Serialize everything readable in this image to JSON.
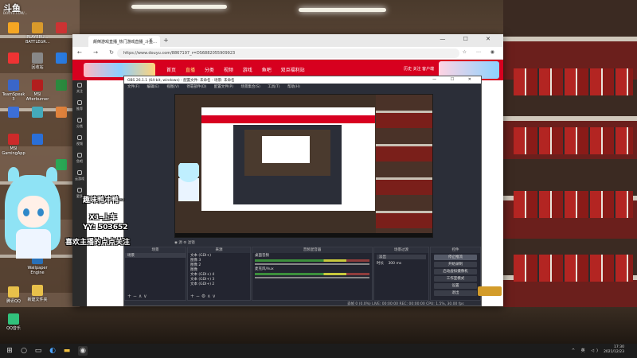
{
  "watermark": {
    "logo": "斗鱼",
    "url": "DOUYU.COM/..."
  },
  "desktop": {
    "icons": [
      {
        "label": "",
        "color": "#f5a623"
      },
      {
        "label": "PLAYERU… BATTLEGR…",
        "color": "#d99a2b"
      },
      {
        "label": "",
        "color": "#c33"
      },
      {
        "label": "",
        "color": "#e33"
      },
      {
        "label": "回收站",
        "color": "#888"
      },
      {
        "label": "",
        "color": "#2a7be0"
      },
      {
        "label": "TeamSpeak 3",
        "color": "#3a66c9"
      },
      {
        "label": "MSI Afterburner",
        "color": "#b21e1e"
      },
      {
        "label": "",
        "color": "#2b8a3e"
      },
      {
        "label": "",
        "color": "#3c6fd8"
      },
      {
        "label": "",
        "color": "#4ab"
      },
      {
        "label": "",
        "color": "#e0823c"
      },
      {
        "label": "MSI GamingApp",
        "color": "#cc2a2a"
      },
      {
        "label": "",
        "color": "#2a6fd8"
      },
      {
        "label": "",
        "color": "#2aa855"
      },
      {
        "label": "",
        "color": "#d9d"
      },
      {
        "label": "Wallpaper Engine",
        "color": "#2870b8"
      },
      {
        "label": "新建文件夹",
        "color": "#e8c04a"
      },
      {
        "label": "腾讯QQ",
        "color": "#2aa8e0"
      },
      {
        "label": "QQ音乐",
        "color": "#31c27c"
      }
    ]
  },
  "browser": {
    "tab_title": "颠倒游戏直播_热门游戏直播_斗鱼…",
    "url": "https://www.douyu.com/8867197_r=DS6882055909923",
    "window_controls": "— ☐ ✕",
    "nav_icons": "← → ↻ ⌂",
    "addr_icons": "☆ ⋯ ◉",
    "site_nav": [
      "首页",
      "直播",
      "分类",
      "视频",
      "游戏",
      "鱼吧",
      "双旦福利站"
    ],
    "site_right": "历史 关注 客户端",
    "rail": [
      "关注",
      "推荐",
      "分类",
      "视频",
      "鱼吧",
      "云游戏",
      "更多"
    ]
  },
  "obs": {
    "title": "OBS 26.1.1 (64-bit, windows) - 配置文件: 未命名 - 场景: 未命名",
    "window_controls": "— ☐ ✕",
    "menu": [
      "文件(F)",
      "编辑(E)",
      "视图(V)",
      "停靠部件(D)",
      "配置文件(P)",
      "场景集合(S)",
      "工具(T)",
      "帮助(H)"
    ],
    "preview_controls": "◉ 源  ⚙ 滤镜",
    "docks": {
      "scenes": {
        "title": "场景",
        "items": [
          "场景"
        ]
      },
      "sources": {
        "title": "来源",
        "items": [
          "文本 (GDI+)",
          "图像 3",
          "图像 2",
          "图像",
          "文本 (GDI+) 4",
          "文本 (GDI+) 3",
          "文本 (GDI+) 2",
          "文本 (GDI+)"
        ]
      },
      "mixer": {
        "title": "音频混音器",
        "tracks": [
          {
            "name": "桌面音频",
            "level": "0.0 dB"
          },
          {
            "name": "麦克风/Aux",
            "level": "0.0 dB"
          }
        ]
      },
      "transitions": {
        "title": "场景过渡",
        "type": "淡出",
        "duration_label": "时长",
        "duration": "300 ms"
      },
      "controls": {
        "title": "控件",
        "buttons": [
          "停止推流",
          "开始录制",
          "启动虚拟摄像机",
          "工作室模式",
          "设置",
          "退出"
        ]
      }
    },
    "status": "丢帧 0 (0.0%)  LIVE: 00:00:00  REC: 00:00:00  CPU: 1.5%, 30.00 fps"
  },
  "overlay": {
    "line1": "趣味鸭冲鸭~",
    "line2": "X1-上车",
    "line3": "YY: 503652",
    "line4": "喜欢主播的点点关注"
  },
  "taskbar": {
    "start": "⊞",
    "tray": "^ 英 ◁)",
    "time": "17:30",
    "date": "2021/12/23"
  }
}
